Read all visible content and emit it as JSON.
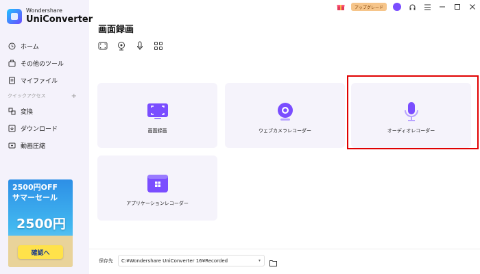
{
  "app": {
    "brand": "Wondershare",
    "product": "UniConverter"
  },
  "titlebar": {
    "icons": [
      "gift-icon",
      "avatar",
      "headset-icon",
      "menu-icon",
      "minimize-icon",
      "maximize-icon",
      "close-icon"
    ],
    "upgrade_label": "アップグレード"
  },
  "sidebar": {
    "items": [
      {
        "label": "ホーム",
        "icon": "home-icon"
      },
      {
        "label": "その他のツール",
        "icon": "toolbox-icon"
      },
      {
        "label": "マイファイル",
        "icon": "file-icon"
      }
    ],
    "quick_access": {
      "label": "クイックアクセス",
      "add": "+"
    },
    "quick_items": [
      {
        "label": "変換",
        "icon": "convert-icon"
      },
      {
        "label": "ダウンロード",
        "icon": "download-icon"
      },
      {
        "label": "動画圧縮",
        "icon": "compress-icon"
      }
    ],
    "promo": {
      "line1": "2500円OFF",
      "line2": "サマーセール",
      "big": "2500円",
      "button": "確認へ"
    }
  },
  "main": {
    "title": "画面録画",
    "mode_tabs": [
      "screen-record-tab",
      "webcam-tab",
      "audio-tab",
      "apps-tab"
    ],
    "cards": [
      {
        "label": "画面録画",
        "icon": "screen-record-icon"
      },
      {
        "label": "ウェブカメラレコーダー",
        "icon": "webcam-icon"
      },
      {
        "label": "オーディオレコーダー",
        "icon": "microphone-icon"
      },
      {
        "label": "アプリケーションレコーダー",
        "icon": "app-window-icon"
      }
    ],
    "save": {
      "label": "保存先",
      "path": "C:¥Wondershare UniConverter 16¥Recorded",
      "caret": "▾"
    }
  },
  "colors": {
    "accent": "#7a4dff",
    "highlight": "#e00000",
    "sidebar_bg": "#f4f2fb",
    "card_bg": "#f5f3fb"
  }
}
